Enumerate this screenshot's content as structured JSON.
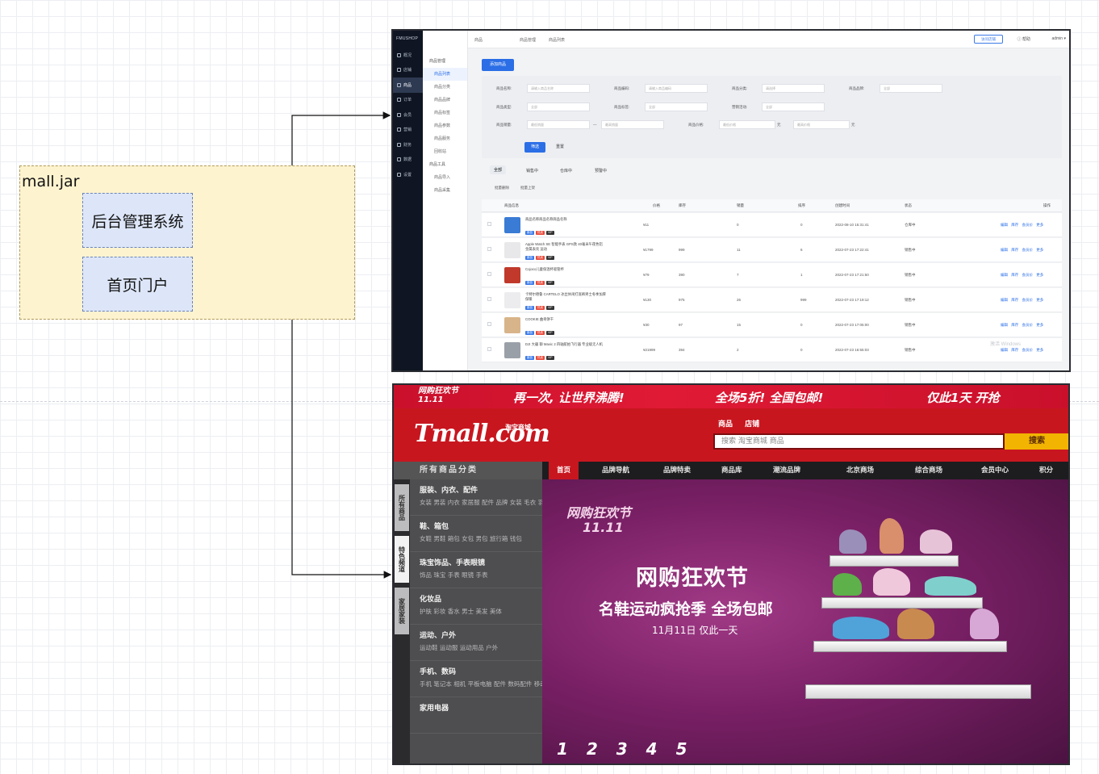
{
  "container": {
    "label": "mall.jar"
  },
  "nodes": {
    "admin": "后台管理系统",
    "portal": "首页门户"
  },
  "admin": {
    "logo": "FMUSHOP",
    "sidebar": [
      "概况",
      "店铺",
      "商品",
      "订单",
      "会员",
      "营销",
      "财务",
      "数据",
      "设置"
    ],
    "submenu": {
      "group1": "商品管理",
      "items": [
        "商品列表",
        "商品分类",
        "商品品牌",
        "商品标签",
        "商品参数",
        "商品服务",
        "回收站"
      ],
      "group2": "商品工具",
      "tools": [
        "商品导入",
        "商品采集"
      ]
    },
    "topbar": {
      "title": "商品",
      "crumb1": "商品管理",
      "crumb2": "商品列表",
      "visit": "访问店铺",
      "help": "帮助",
      "user": "admin"
    },
    "add_button": "添加商品",
    "filters": {
      "name_label": "商品名称:",
      "name_ph": "请输入商品名称",
      "code_label": "商品编码:",
      "code_ph": "请输入商品编码",
      "cat_label": "商品分类:",
      "cat_ph": "请选择",
      "brand_label": "商品品牌:",
      "brand_ph": "全部",
      "type_label": "商品类型:",
      "type_ph": "全部",
      "tag_label": "商品标签:",
      "tag_ph": "全部",
      "promo_label": "营销活动:",
      "promo_ph": "全部",
      "sales_label": "商品销量:",
      "sales_min": "最低销量",
      "sales_max": "最高销量",
      "price_label": "商品价格:",
      "price_min": "最低价格",
      "price_max": "最高价格",
      "unit": "元",
      "search": "筛选",
      "reset": "重置"
    },
    "tabs": [
      "全部",
      "销售中",
      "仓库中",
      "预警中"
    ],
    "batch": [
      "批量删除",
      "批量上架"
    ],
    "columns": [
      "商品信息",
      "价格",
      "库存",
      "销量",
      "排序",
      "创建时间",
      "状态",
      "操作"
    ],
    "rows": [
      {
        "name": "商品名称商品名称商品名称",
        "price": "¥11",
        "stock": "",
        "sales": "0",
        "sort": "0",
        "created": "2022-08-10 15:31:41",
        "status": "仓库中"
      },
      {
        "name": "Apple Watch SE 智能手表 GPS款 40毫米午夜色铝金属表壳 运动",
        "price": "¥1799",
        "stock": "999",
        "sales": "11",
        "sort": "6",
        "created": "2022-07-23 17:22:41",
        "status": "销售中"
      },
      {
        "name": "Cojoco儿童保温杯吸管杯",
        "price": "¥79",
        "stock": "390",
        "sales": "7",
        "sort": "1",
        "created": "2022-07-23 17:21:50",
        "status": "销售中"
      },
      {
        "name": "卡特尔德鲁 CARTELO 冰丝休闲打底裤男士冬季加厚保暖",
        "price": "¥130",
        "stock": "975",
        "sales": "26",
        "sort": "999",
        "created": "2022-07-23 17:19:12",
        "status": "销售中"
      },
      {
        "name": "COOKIE 曲奇饼干",
        "price": "¥30",
        "stock": "97",
        "sales": "15",
        "sort": "0",
        "created": "2022-07-23 17:05:00",
        "status": "销售中"
      },
      {
        "name": "DJI 大疆 御 Mavic 2 四轴航拍飞行器 专业级无人机",
        "price": "¥21999",
        "stock": "394",
        "sales": "2",
        "sort": "0",
        "created": "2022-07-23 16:55:03",
        "status": "销售中"
      }
    ],
    "row_ops": "编辑 库存 会员价 更多",
    "tags": {
      "new": "新品",
      "hot": "热卖",
      "vip": "VIP"
    },
    "watermark": "激活 Windows"
  },
  "portal": {
    "banner": {
      "left": "网购狂欢节 11.11",
      "mid": "再一次, 让世界沸腾!",
      "right": "全场5折! 全国包邮!",
      "end": "仅此1天 开抢"
    },
    "logo": "Tmall.com",
    "sublogo": "淘宝商城",
    "search_tabs": [
      "商品",
      "店铺"
    ],
    "search_ph": "搜索 淘宝商城 商品",
    "search_btn": "搜索",
    "all_cats": "所有商品分类",
    "nav": [
      "首页",
      "品牌导航",
      "品牌特卖",
      "商品库",
      "潮流品牌",
      "北京商场",
      "综合商场",
      "会员中心",
      "积分"
    ],
    "side_tabs": [
      "所有商品",
      "特色频道",
      "家居家装"
    ],
    "categories": [
      {
        "title": "服装、内衣、配件",
        "sub": "女装 男装 内衣 家居服 配件 品牌 女装 毛衣 羽绒服 风衣"
      },
      {
        "title": "鞋、箱包",
        "sub": "女鞋 男鞋 箱包 女包 男包 旅行箱 钱包"
      },
      {
        "title": "珠宝饰品、手表眼镜",
        "sub": "饰品 珠宝 手表 眼镜 手表"
      },
      {
        "title": "化妆品",
        "sub": "护肤 彩妆 香水 男士 美发 美体"
      },
      {
        "title": "运动、户外",
        "sub": "运动鞋 运动服 运动用品 户外"
      },
      {
        "title": "手机、数码",
        "sub": "手机 笔记本 相机 平板电脑 配件 数码配件 移动存储"
      },
      {
        "title": "家用电器",
        "sub": ""
      }
    ],
    "hero": {
      "badge": "网购狂欢节",
      "badge2": "11.11",
      "title": "网购狂欢节",
      "subtitle": "名鞋运动疯抢季 全场包邮",
      "date": "11月11日 仅此一天",
      "pages": [
        "1",
        "2",
        "3",
        "4",
        "5"
      ]
    },
    "colors": {
      "primary": "#c8161f",
      "hero": "#7a2066",
      "accent": "#f2b400"
    }
  }
}
